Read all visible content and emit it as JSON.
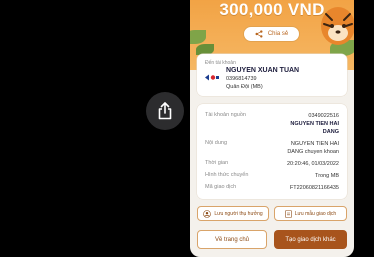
{
  "hero": {
    "amount": "300,000 VND",
    "share_label": "Chia sẻ"
  },
  "recipient": {
    "label": "Đến tài khoản",
    "name": "NGUYEN XUAN TUAN",
    "account": "0396814739",
    "bank": "Quân Đội (MB)"
  },
  "details": {
    "source_account": {
      "label": "Tài khoản nguồn",
      "number": "0349022516",
      "name_line1": "NGUYEN TIEN HAI",
      "name_line2": "DANG"
    },
    "content": {
      "label": "Nội dung",
      "line1": "NGUYEN TIEN HAI",
      "line2": "DANG chuyen khoan"
    },
    "time": {
      "label": "Thời gian",
      "value": "20:20:46, 01/03/2022"
    },
    "method": {
      "label": "Hình thức chuyển",
      "value": "Trong MB"
    },
    "tx_code": {
      "label": "Mã giao dịch",
      "value": "FT22060821166435"
    }
  },
  "actions": {
    "save_beneficiary": "Lưu người thụ hưởng",
    "save_template": "Lưu mẫu giao dịch",
    "home": "Về trang chủ",
    "new_transaction": "Tạo giao dịch khác"
  },
  "colors": {
    "accent": "#a8541c",
    "hero_bg": "#f2a345",
    "background": "#f4f1ec"
  }
}
